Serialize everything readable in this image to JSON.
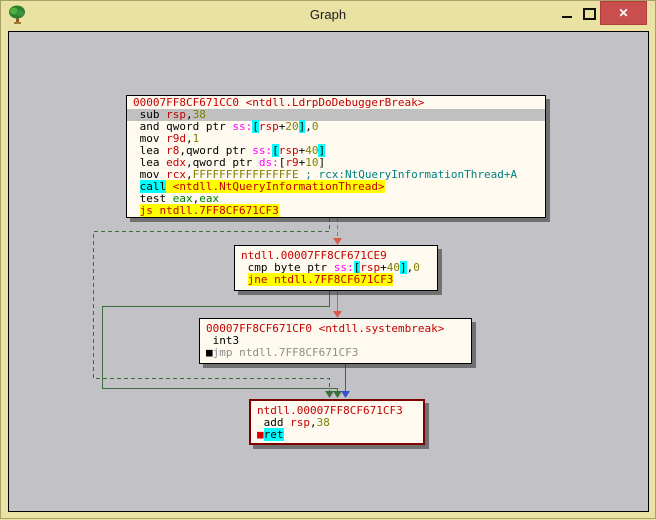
{
  "window": {
    "title": "Graph",
    "close_glyph": "✕",
    "titlebar_color": "#e9e2a3",
    "close_button_color": "#c94f4f"
  },
  "graph": {
    "canvas_color": "#c2c2c6",
    "block_bg_color": "#fffaef",
    "selected_block_border_color": "#7d0000",
    "edge_colors": {
      "taken": "#3c6e3c",
      "not_taken": "#dd5a4a",
      "unconditional": "#3350d0"
    },
    "blocks": [
      {
        "header": "00007FF8CF671CC0 <ntdll.LdrpDoDebuggerBreak>",
        "lines": [
          {
            "sel": true,
            "tokens": [
              [
                "m",
                " sub "
              ],
              [
                "reg",
                "rsp"
              ],
              [
                "m",
                ","
              ],
              [
                "num",
                "38"
              ]
            ]
          },
          {
            "tokens": [
              [
                "m",
                " and qword ptr "
              ],
              [
                "seg",
                "ss:"
              ],
              [
                "brk",
                "["
              ],
              [
                "reg",
                "rsp"
              ],
              [
                "m",
                "+"
              ],
              [
                "num",
                "20"
              ],
              [
                "brk",
                "]"
              ],
              [
                "m",
                ","
              ],
              [
                "num",
                "0"
              ]
            ]
          },
          {
            "tokens": [
              [
                "m",
                " mov "
              ],
              [
                "reg",
                "r9d"
              ],
              [
                "m",
                ","
              ],
              [
                "num",
                "1"
              ]
            ]
          },
          {
            "tokens": [
              [
                "m",
                " lea "
              ],
              [
                "reg",
                "r8"
              ],
              [
                "m",
                ",qword ptr "
              ],
              [
                "seg",
                "ss:"
              ],
              [
                "brk",
                "["
              ],
              [
                "reg",
                "rsp"
              ],
              [
                "m",
                "+"
              ],
              [
                "num",
                "40"
              ],
              [
                "brk",
                "]"
              ]
            ]
          },
          {
            "tokens": [
              [
                "m",
                " lea "
              ],
              [
                "reg",
                "edx"
              ],
              [
                "m",
                ",qword ptr "
              ],
              [
                "seg",
                "ds:"
              ],
              [
                "m",
                "["
              ],
              [
                "reg",
                "r9"
              ],
              [
                "m",
                "+"
              ],
              [
                "num",
                "10"
              ],
              [
                "m",
                "]"
              ]
            ]
          },
          {
            "tokens": [
              [
                "m",
                " mov "
              ],
              [
                "reg",
                "rcx"
              ],
              [
                "m",
                ","
              ],
              [
                "num",
                "FFFFFFFFFFFFFFFE"
              ],
              [
                "cmt",
                " ; rcx:NtQueryInformationThread+A"
              ]
            ]
          },
          {
            "tokens": [
              [
                "m",
                " "
              ],
              [
                "hlC",
                "call"
              ],
              [
                "hlY",
                " <ntdll.NtQueryInformationThread>"
              ]
            ]
          },
          {
            "tokens": [
              [
                "m",
                " test "
              ],
              [
                "grn",
                "eax"
              ],
              [
                "m",
                ","
              ],
              [
                "grn",
                "eax"
              ]
            ]
          },
          {
            "tokens": [
              [
                "m",
                " "
              ],
              [
                "hlY",
                "js ntdll.7FF8CF671CF3"
              ]
            ]
          }
        ]
      },
      {
        "header": "ntdll.00007FF8CF671CE9",
        "lines": [
          {
            "tokens": [
              [
                "m",
                " cmp byte ptr "
              ],
              [
                "seg",
                "ss:"
              ],
              [
                "brk",
                "["
              ],
              [
                "reg",
                "rsp"
              ],
              [
                "m",
                "+"
              ],
              [
                "num",
                "40"
              ],
              [
                "brk",
                "]"
              ],
              [
                "m",
                ","
              ],
              [
                "num",
                "0"
              ]
            ]
          },
          {
            "tokens": [
              [
                "m",
                " "
              ],
              [
                "hlY",
                "jne ntdll.7FF8CF671CF3"
              ]
            ]
          }
        ]
      },
      {
        "header": "00007FF8CF671CF0 <ntdll.systembreak>",
        "lines": [
          {
            "tokens": [
              [
                "m",
                " int3"
              ]
            ]
          },
          {
            "tokens": [
              [
                "bpB",
                "■"
              ],
              [
                "gray",
                "jmp ntdll.7FF8CF671CF3"
              ]
            ]
          }
        ]
      },
      {
        "header": "ntdll.00007FF8CF671CF3",
        "lines": [
          {
            "tokens": [
              [
                "m",
                " add "
              ],
              [
                "reg",
                "rsp"
              ],
              [
                "m",
                ","
              ],
              [
                "num",
                "38"
              ]
            ]
          },
          {
            "tokens": [
              [
                "bpR",
                "■"
              ],
              [
                "hlC",
                "ret"
              ]
            ]
          }
        ]
      }
    ]
  }
}
